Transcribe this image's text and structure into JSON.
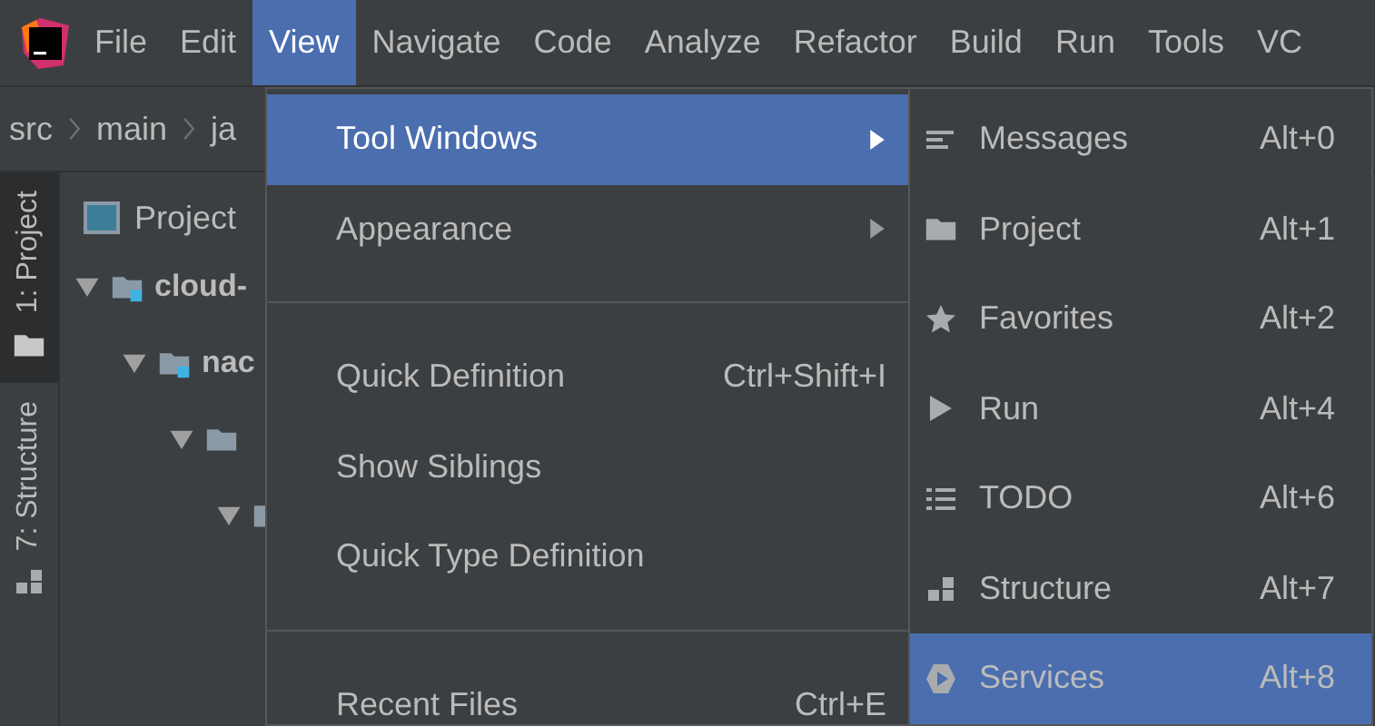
{
  "menu_bar": [
    {
      "label": "File",
      "selected": false
    },
    {
      "label": "Edit",
      "selected": false
    },
    {
      "label": "View",
      "selected": true
    },
    {
      "label": "Navigate",
      "selected": false
    },
    {
      "label": "Code",
      "selected": false
    },
    {
      "label": "Analyze",
      "selected": false
    },
    {
      "label": "Refactor",
      "selected": false
    },
    {
      "label": "Build",
      "selected": false
    },
    {
      "label": "Run",
      "selected": false
    },
    {
      "label": "Tools",
      "selected": false
    },
    {
      "label": "VC",
      "selected": false
    }
  ],
  "breadcrumbs": [
    "src",
    "main",
    "ja"
  ],
  "tool_tabs": [
    {
      "label": "1: Project",
      "selected": true
    },
    {
      "label": "7: Structure",
      "selected": false
    }
  ],
  "project_panel": {
    "title": "Project",
    "tree": [
      {
        "label": "cloud-",
        "expanded": true,
        "module": true,
        "children": [
          {
            "label": "nac",
            "expanded": true,
            "module": true,
            "children": [
              {
                "expanded": true,
                "module": false,
                "children": [
                  {
                    "expanded": true,
                    "module": false
                  }
                ]
              }
            ]
          }
        ]
      }
    ]
  },
  "view_menu": [
    {
      "kind": "item",
      "label": "Tool Windows",
      "submenu": true,
      "selected": true
    },
    {
      "kind": "item",
      "label": "Appearance",
      "submenu": true,
      "selected": false
    },
    {
      "kind": "separator"
    },
    {
      "kind": "item",
      "label": "Quick Definition",
      "shortcut": "Ctrl+Shift+I",
      "selected": false
    },
    {
      "kind": "item",
      "label": "Show Siblings",
      "selected": false
    },
    {
      "kind": "item",
      "label": "Quick Type Definition",
      "selected": false
    },
    {
      "kind": "separator"
    },
    {
      "kind": "item",
      "label": "Recent Files",
      "shortcut": "Ctrl+E",
      "selected": false
    }
  ],
  "tool_windows_menu": [
    {
      "label": "Messages",
      "shortcut": "Alt+0",
      "selected": false
    },
    {
      "label": "Project",
      "shortcut": "Alt+1",
      "selected": false
    },
    {
      "label": "Favorites",
      "shortcut": "Alt+2",
      "selected": false
    },
    {
      "label": "Run",
      "shortcut": "Alt+4",
      "selected": false
    },
    {
      "label": "TODO",
      "shortcut": "Alt+6",
      "selected": false
    },
    {
      "label": "Structure",
      "shortcut": "Alt+7",
      "selected": false
    },
    {
      "label": "Services",
      "shortcut": "Alt+8",
      "selected": true
    }
  ]
}
